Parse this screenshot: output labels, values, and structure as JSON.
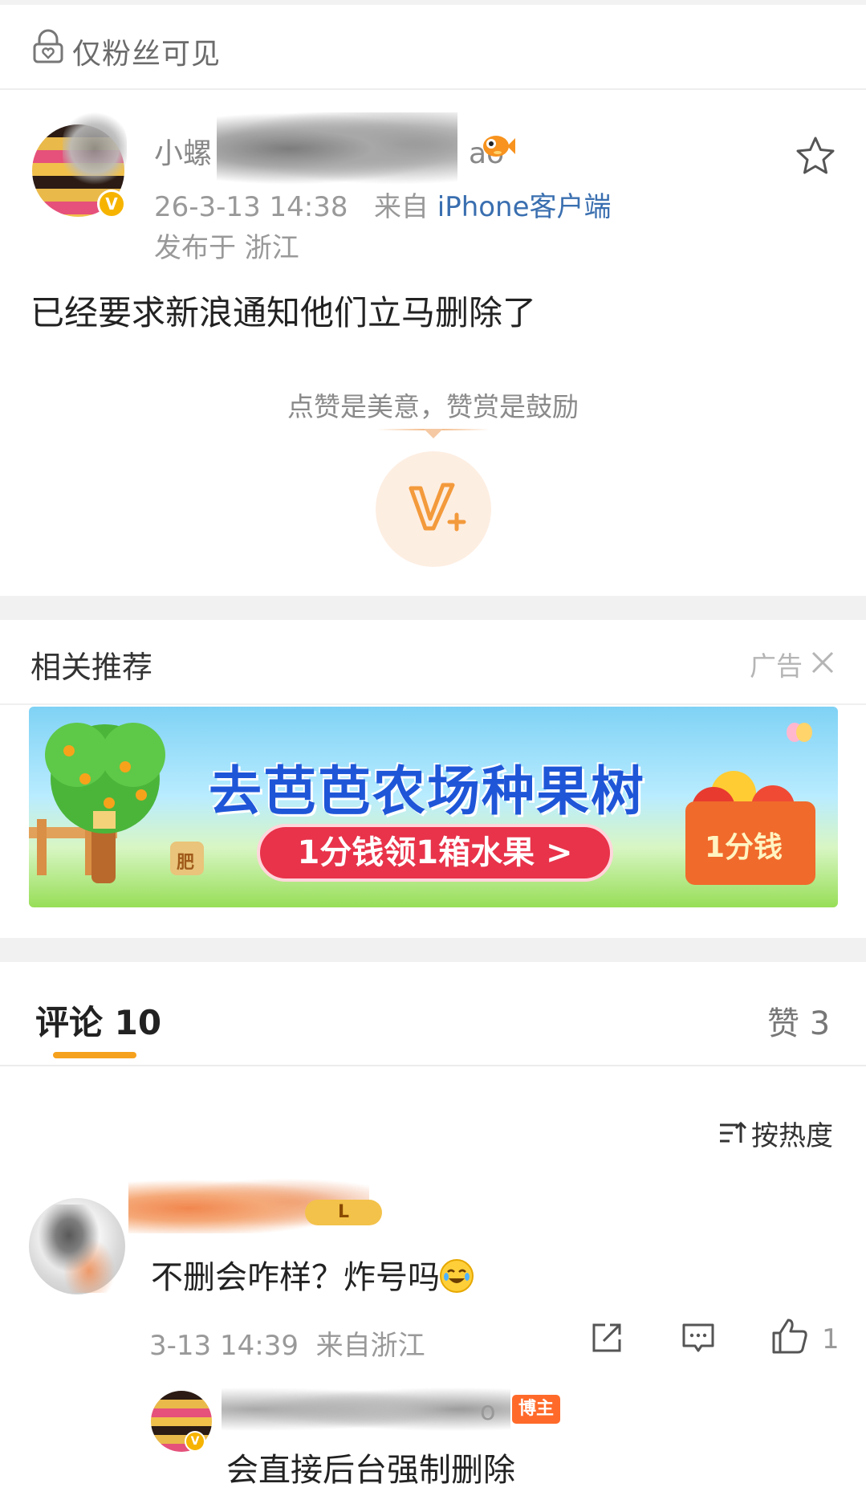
{
  "visibility": {
    "label": "仅粉丝可见",
    "icon": "lock-heart-icon"
  },
  "post": {
    "author_name_partial": "小螺",
    "author_name_tail": "ao",
    "verified_badge": "V",
    "timestamp": "26-3-13 14:38",
    "source_prefix": "来自",
    "source": "iPhone客户端",
    "location": "发布于 浙江",
    "text": "已经要求新浪通知他们立马删除了"
  },
  "reward": {
    "hint": "点赞是美意，赞赏是鼓励",
    "button_label": "V+"
  },
  "recommend": {
    "title": "相关推荐",
    "ad_label": "广告",
    "banner": {
      "headline": "去芭芭农场种果树",
      "cta": "1分钱领1箱水果 >",
      "box_text": "1分钱",
      "bag_label": "肥"
    }
  },
  "tabs": {
    "comments": "评论 10",
    "likes": "赞 3"
  },
  "sort": {
    "label": "按热度"
  },
  "comment": {
    "level_badge": "L",
    "text": "不删会咋样？炸号吗",
    "timestamp": "3-13 14:39",
    "location": "来自浙江",
    "like_count": "1"
  },
  "reply": {
    "author_tail": "o",
    "badge": "博主",
    "text": "会直接后台强制删除"
  },
  "colors": {
    "accent_orange": "#f6a11d",
    "link_blue": "#3a6fb0",
    "verified_gold": "#f6b400",
    "banner_blue": "#1f56d8",
    "banner_red": "#e8334a"
  }
}
